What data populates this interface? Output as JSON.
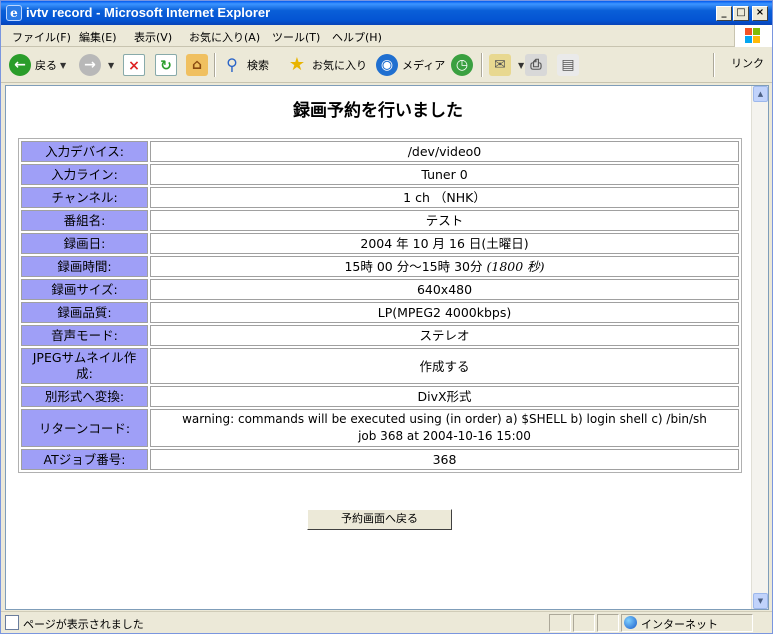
{
  "window": {
    "title": "ivtv record - Microsoft Internet Explorer"
  },
  "menu": [
    "ファイル(F)",
    "編集(E)",
    "表示(V)",
    "お気に入り(A)",
    "ツール(T)",
    "ヘルプ(H)"
  ],
  "toolbar": {
    "back": "戻る",
    "search": "検索",
    "favorites": "お気に入り",
    "media": "メディア",
    "links": "リンク"
  },
  "page": {
    "heading": "録画予約を行いました",
    "rows": [
      {
        "label": "入力デバイス:",
        "value": "/dev/video0"
      },
      {
        "label": "入力ライン:",
        "value": "Tuner 0"
      },
      {
        "label": "チャンネル:",
        "value": "1 ch （NHK）"
      },
      {
        "label": "番組名:",
        "value": "テスト"
      },
      {
        "label": "録画日:",
        "value": "2004 年 10 月 16 日(土曜日)"
      },
      {
        "label": "録画時間:",
        "value": "15時 00 分〜15時 30分",
        "value_extra": "(1800 秒)"
      },
      {
        "label": "録画サイズ:",
        "value": "640x480"
      },
      {
        "label": "録画品質:",
        "value": "LP(MPEG2 4000kbps)"
      },
      {
        "label": "音声モード:",
        "value": "ステレオ"
      },
      {
        "label": "JPEGサムネイル作成:",
        "value": "作成する"
      },
      {
        "label": "別形式へ変換:",
        "value": "DivX形式"
      },
      {
        "label": "リターンコード:",
        "value": "warning: commands will be executed using (in order) a) $SHELL b) login shell c) /bin/sh",
        "value_line2": "job 368 at 2004-10-16 15:00"
      },
      {
        "label": "ATジョブ番号:",
        "value": "368"
      }
    ],
    "back_button": "予約画面へ戻る"
  },
  "status": {
    "text": "ページが表示されました",
    "zone": "インターネット"
  }
}
